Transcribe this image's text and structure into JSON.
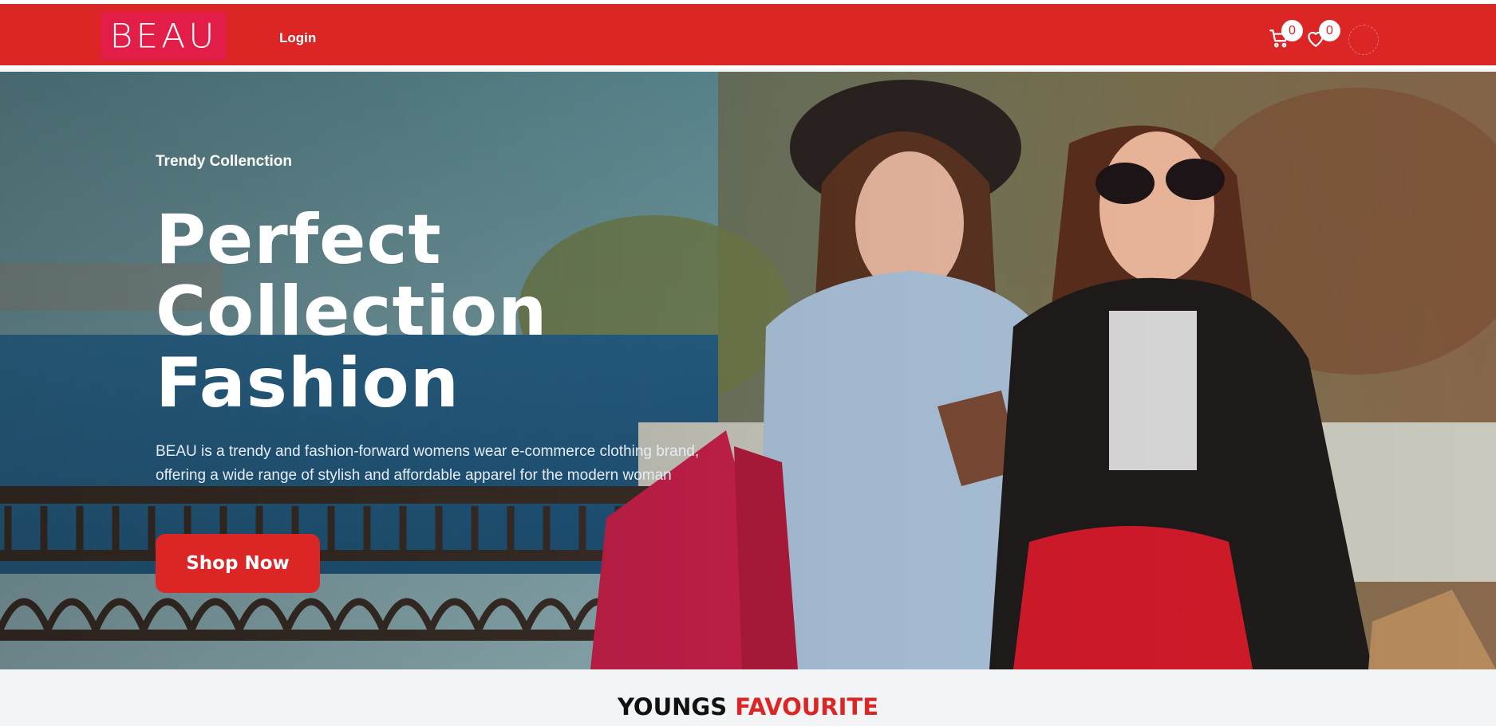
{
  "brand": {
    "logo_text": "BEAU",
    "primary_color": "#dc2626",
    "logo_bg": "#e11d48"
  },
  "nav": {
    "login_label": "Login",
    "cart": {
      "icon": "cart-icon",
      "count": "0"
    },
    "wishlist": {
      "icon": "heart-icon",
      "count": "0"
    },
    "profile": {
      "icon": "user-avatar"
    }
  },
  "hero": {
    "eyebrow": "Trendy Collenction",
    "headline_lines": [
      "Perfect",
      "Collection",
      "Fashion"
    ],
    "description": "BEAU is a trendy and fashion-forward womens wear e-commerce clothing brand, offering a wide range of stylish and affordable apparel for the modern woman",
    "cta_label": "Shop Now",
    "image": "two-women-shopping-photo"
  },
  "section": {
    "title_part1": "YOUNGS",
    "title_part2": "FAVOURITE"
  }
}
